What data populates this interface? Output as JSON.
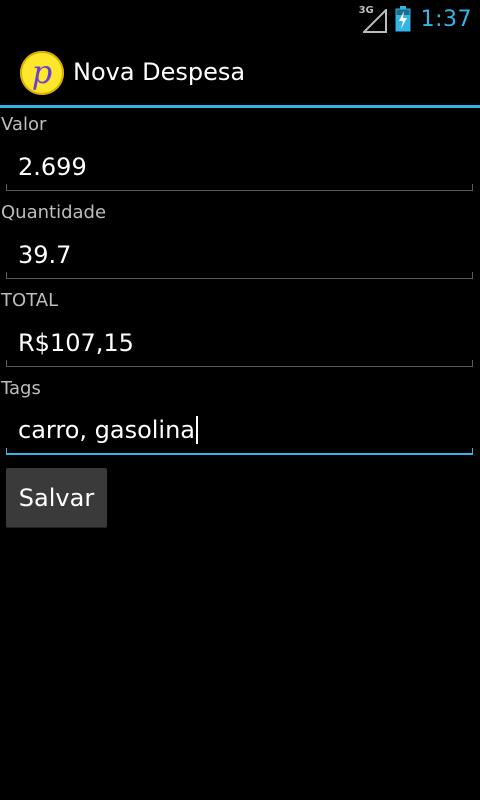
{
  "status_bar": {
    "network": "3G",
    "time": "1:37",
    "battery_icon": "battery-charging-icon",
    "signal_icon": "signal-icon",
    "accent": "#33b5e5"
  },
  "action_bar": {
    "title": "Nova Despesa",
    "app_icon_glyph": "p",
    "app_icon_color": "#ffe82b"
  },
  "form": {
    "fields": [
      {
        "label": "Valor",
        "value": "2.699"
      },
      {
        "label": "Quantidade",
        "value": "39.7"
      },
      {
        "label": "TOTAL",
        "value": "R$107,15"
      },
      {
        "label": "Tags",
        "value": "carro, gasolina",
        "focused": true
      }
    ],
    "save_label": "Salvar"
  }
}
